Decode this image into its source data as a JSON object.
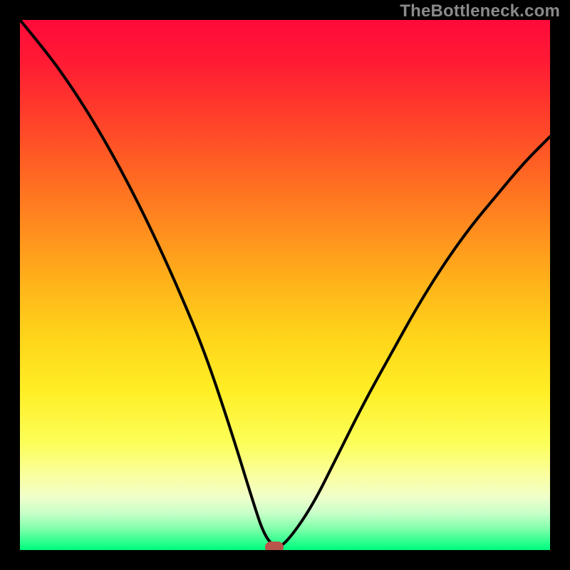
{
  "watermark": "TheBottleneck.com",
  "colors": {
    "frame_bg": "#000000",
    "curve": "#000000",
    "marker": "#b8564b",
    "gradient_stops": [
      "#ff0a3a",
      "#ff1b34",
      "#ff3e2a",
      "#ff6a22",
      "#ff8f1e",
      "#ffb41a",
      "#ffd51a",
      "#ffee25",
      "#fcff5a",
      "#faffa0",
      "#f0ffca",
      "#c9ffc9",
      "#7fffaa",
      "#1aff88",
      "#00f97e"
    ]
  },
  "chart_data": {
    "type": "line",
    "title": "",
    "xlabel": "",
    "ylabel": "",
    "xlim": [
      0,
      100
    ],
    "ylim": [
      0,
      100
    ],
    "note": "V-shaped bottleneck curve; background gradient encodes severity (red=high, green=low). Minimum at x≈48, y≈0.",
    "series": [
      {
        "name": "bottleneck-curve",
        "x": [
          0,
          5,
          10,
          15,
          20,
          25,
          30,
          35,
          40,
          44,
          46,
          48,
          50,
          55,
          60,
          65,
          70,
          75,
          80,
          85,
          90,
          95,
          100
        ],
        "values": [
          100,
          94,
          87,
          79,
          70,
          60,
          49,
          37,
          22,
          9,
          3,
          0.5,
          1,
          8,
          18,
          28,
          37,
          46,
          54,
          61,
          67,
          73,
          78
        ]
      }
    ],
    "marker": {
      "x": 48,
      "y": 0.5,
      "label": "optimal-point"
    }
  }
}
